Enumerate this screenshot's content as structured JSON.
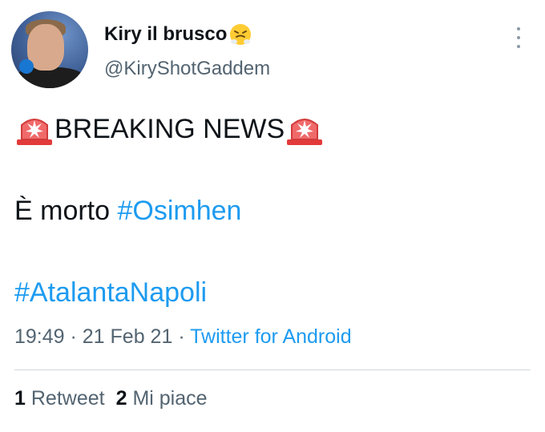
{
  "author": {
    "display_name": "Kiry il brusco",
    "handle": "@KiryShotGaddem",
    "name_emoji": "face-with-steam-from-nose-icon"
  },
  "tweet": {
    "line1_text": "BREAKING NEWS",
    "line1_emoji": "police-car-light-icon",
    "line2_prefix": "È morto ",
    "line2_hashtag": "#Osimhen",
    "line3_hashtag": "#AtalantaNapoli"
  },
  "meta": {
    "time": "19:49",
    "sep1": " · ",
    "date": "21 Feb 21",
    "sep2": " · ",
    "source": "Twitter for Android"
  },
  "stats": {
    "retweet_count": "1",
    "retweet_label": "Retweet",
    "like_count": "2",
    "like_label": "Mi piace"
  },
  "colors": {
    "link": "#1d9bf0",
    "secondary_text": "#536471",
    "primary_text": "#0f1419",
    "divider": "#cfd9de"
  }
}
